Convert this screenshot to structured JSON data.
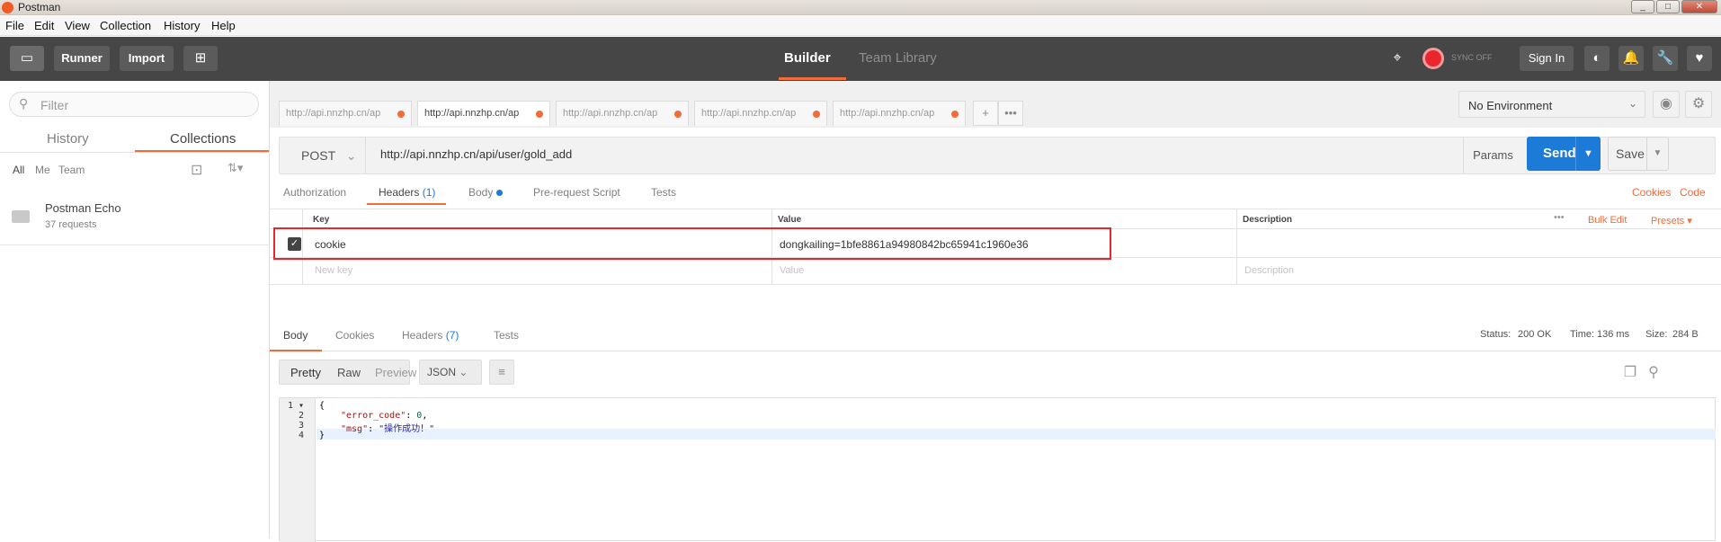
{
  "window": {
    "title": "Postman",
    "min": "_",
    "max": "□",
    "close": "✕"
  },
  "menu": [
    "File",
    "Edit",
    "View",
    "Collection",
    "History",
    "Help"
  ],
  "header": {
    "runner": "Runner",
    "import": "Import",
    "builder": "Builder",
    "team_library": "Team Library",
    "sync": "SYNC OFF",
    "sign_in": "Sign In"
  },
  "sidebar": {
    "filter_placeholder": "Filter",
    "tabs": [
      "History",
      "Collections"
    ],
    "filters": [
      "All",
      "Me",
      "Team"
    ],
    "collection": {
      "name": "Postman Echo",
      "count": "37 requests"
    }
  },
  "request_tabs": [
    "http://api.nnzhp.cn/ap",
    "http://api.nnzhp.cn/ap",
    "http://api.nnzhp.cn/ap",
    "http://api.nnzhp.cn/ap",
    "http://api.nnzhp.cn/ap"
  ],
  "environment": "No Environment",
  "request": {
    "method": "POST",
    "url": "http://api.nnzhp.cn/api/user/gold_add",
    "params": "Params",
    "send": "Send",
    "save": "Save"
  },
  "request_tabs2": {
    "authorization": "Authorization",
    "headers": "Headers",
    "headers_count": "(1)",
    "body": "Body",
    "prerequest": "Pre-request Script",
    "tests": "Tests",
    "cookies": "Cookies",
    "code": "Code"
  },
  "headers_table": {
    "cols": [
      "Key",
      "Value",
      "Description"
    ],
    "bulk_edit": "Bulk Edit",
    "presets": "Presets",
    "row": {
      "key": "cookie",
      "value": "dongkailing=1bfe8861a94980842bc65941c1960e36"
    },
    "new_key": "New key",
    "new_value": "Value",
    "new_desc": "Description"
  },
  "response": {
    "tabs": {
      "body": "Body",
      "cookies": "Cookies",
      "headers": "Headers",
      "headers_count": "(7)",
      "tests": "Tests"
    },
    "status_label": "Status:",
    "status": "200 OK",
    "time_label": "Time:",
    "time": "136 ms",
    "size_label": "Size:",
    "size": "284 B",
    "views": [
      "Pretty",
      "Raw",
      "Preview"
    ],
    "format": "JSON"
  },
  "code_lines": {
    "l1": "{",
    "l2_key": "\"error_code\"",
    "l2_rest": ": ",
    "l2_val": "0",
    "l2_end": ",",
    "l3_key": "\"msg\"",
    "l3_rest": ": ",
    "l3_val": "\"操作成功！\"",
    "l4": "}"
  },
  "colors": {
    "accent": "#f26b3a",
    "blue": "#1c7bd6",
    "header_bg": "#464646",
    "highlight": "#e8262b"
  }
}
